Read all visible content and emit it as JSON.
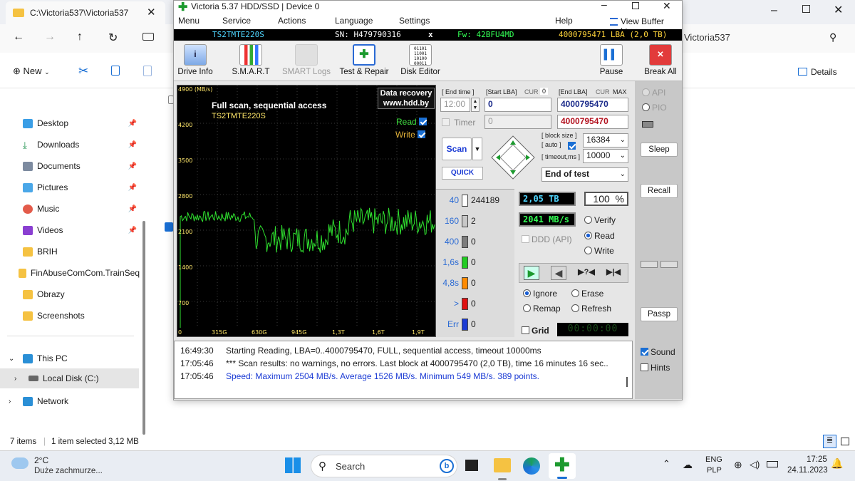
{
  "explorer": {
    "tab_title": "C:\\Victoria537\\Victoria537",
    "address_tail": "Victoria537",
    "new_label": "New",
    "details_label": "Details",
    "nav": {
      "quick": [
        "Desktop",
        "Downloads",
        "Documents",
        "Pictures",
        "Music",
        "Videos"
      ],
      "folders": [
        "BRIH",
        "FinAbuseComCom.TrainSeq",
        "Obrazy",
        "Screenshots"
      ],
      "this_pc": "This PC",
      "local_disk": "Local Disk (C:)",
      "network": "Network"
    },
    "status": {
      "items": "7 items",
      "selected": "1 item selected",
      "size": "3,12 MB"
    }
  },
  "victoria": {
    "title": "Victoria 5.37 HDD/SSD | Device 0",
    "menu": [
      "Menu",
      "Service",
      "Actions",
      "Language",
      "Settings"
    ],
    "menu_help": "Help",
    "view_buffer": "View Buffer Live",
    "info": {
      "model": "TS2TMTE220S",
      "sn": "SN: H479790316",
      "fw": "Fw: 42BFU4MD",
      "lba": "4000795471 LBA (2,0 TB)"
    },
    "toolbar": [
      "Drive Info",
      "S.M.A.R.T",
      "SMART Logs",
      "Test & Repair",
      "Disk Editor"
    ],
    "pause": "Pause",
    "break_all": "Break All",
    "graph": {
      "title": "Full scan, sequential access",
      "model": "TS2TMTE220S",
      "watermark1": "Data recovery",
      "watermark2": "www.hdd.by",
      "read": "Read",
      "write": "Write",
      "yticks": [
        "4900 (MB/s)",
        "4200",
        "3500",
        "2800",
        "2100",
        "1400",
        "700",
        "0"
      ],
      "xticks": [
        "315G",
        "630G",
        "945G",
        "1,3T",
        "1,6T",
        "1,9T"
      ]
    },
    "controls": {
      "end_time_label": "[ End time ]",
      "start_lba_label": "[Start LBA]",
      "cur": "CUR",
      "zero": "0",
      "end_lba_label": "[End LBA]",
      "cur2": "CUR",
      "max": "MAX",
      "time": "12:00",
      "start_lba": "0",
      "end_lba": "4000795470",
      "timer_label": "Timer",
      "timer_val": "0",
      "end_lba2": "4000795470",
      "scan": "Scan",
      "quick": "QUICK",
      "block_size_label": "[ block size ]",
      "auto_label": "[ auto ]",
      "timeout_label": "[ timeout,ms ]",
      "block_size": "16384",
      "timeout": "10000",
      "end_of_test": "End of test"
    },
    "stats": [
      {
        "label": "40",
        "count": "244189",
        "color": "#ffffff"
      },
      {
        "label": "160",
        "count": "2",
        "color": "#c8c8c8"
      },
      {
        "label": "400",
        "count": "0",
        "color": "#7d7d7d"
      },
      {
        "label": "1,6s",
        "count": "0",
        "color": "#22cc22"
      },
      {
        "label": "4,8s",
        "count": "0",
        "color": "#ff8a00"
      },
      {
        "label": ">",
        "count": "0",
        "color": "#e01010"
      },
      {
        "label": "Err",
        "count": "0",
        "color": "#1a3ad4"
      }
    ],
    "progress": {
      "size": "2,05 TB",
      "percent": "100",
      "pct_sign": "%",
      "speed": "2041 MB/s",
      "ddd": "DDD (API)"
    },
    "modes": {
      "verify": "Verify",
      "read": "Read",
      "write": "Write"
    },
    "actions": {
      "ignore": "Ignore",
      "erase": "Erase",
      "remap": "Remap",
      "refresh": "Refresh"
    },
    "grid": "Grid",
    "grid_time": "00:00:00",
    "side": {
      "api": "API",
      "pio": "PIO",
      "sleep": "Sleep",
      "recall": "Recall",
      "passp": "Passp"
    },
    "log": [
      {
        "time": "16:49:30",
        "text": "Starting Reading, LBA=0..4000795470, FULL, sequential access, timeout 10000ms"
      },
      {
        "time": "17:05:46",
        "text": "*** Scan results: no warnings, no errors. Last block at 4000795470 (2,0 TB), time 16 minutes 16 sec.."
      },
      {
        "time": "17:05:46",
        "text": "Speed: Maximum 2504 MB/s. Average 1526 MB/s. Minimum 549 MB/s. 389 points."
      }
    ],
    "sound": "Sound",
    "hints": "Hints"
  },
  "taskbar": {
    "temp": "2°C",
    "weather": "Duże zachmurze...",
    "search": "Search",
    "lang1": "ENG",
    "lang2": "PLP",
    "time": "17:25",
    "date": "24.11.2023"
  }
}
